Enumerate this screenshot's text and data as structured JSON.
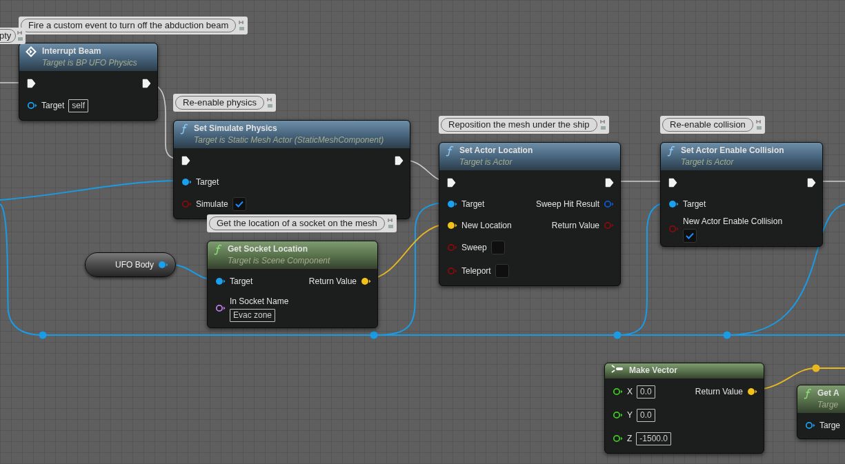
{
  "comments": [
    {
      "text": "pty"
    }
  ],
  "nodes": [
    {
      "kind": "event",
      "comment": "Fire a custom event to turn off the abduction beam",
      "title": "Interrupt Beam",
      "subtitle": "Target is BP UFO Physics",
      "rows": [
        {
          "left": {
            "kind": "exec",
            "connected": true
          },
          "right": {
            "kind": "exec",
            "connected": true
          }
        },
        {
          "left": {
            "kind": "object",
            "label": "Target",
            "connected": false,
            "value": "self"
          }
        }
      ]
    },
    {
      "kind": "function",
      "comment": "Re-enable physics",
      "title": "Set Simulate Physics",
      "subtitle": "Target is Static Mesh Actor (StaticMeshComponent)",
      "rows": [
        {
          "left": {
            "kind": "exec",
            "connected": true
          },
          "right": {
            "kind": "exec",
            "connected": true
          }
        },
        {
          "left": {
            "kind": "object",
            "label": "Target",
            "connected": true
          }
        },
        {
          "left": {
            "kind": "bool",
            "label": "Simulate",
            "connected": false,
            "checked": true
          }
        }
      ]
    },
    {
      "kind": "function",
      "comment": "Reposition the mesh under the ship",
      "title": "Set Actor Location",
      "subtitle": "Target is Actor",
      "rows": [
        {
          "left": {
            "kind": "exec",
            "connected": true
          },
          "right": {
            "kind": "exec",
            "connected": true
          }
        },
        {
          "left": {
            "kind": "object",
            "label": "Target",
            "connected": true
          },
          "right": {
            "kind": "struct",
            "label": "Sweep Hit Result",
            "connected": false
          }
        },
        {
          "left": {
            "kind": "vector",
            "label": "New Location",
            "connected": true
          },
          "right": {
            "kind": "bool",
            "label": "Return Value",
            "connected": false
          }
        },
        {
          "left": {
            "kind": "bool",
            "label": "Sweep",
            "connected": false,
            "checked": false
          }
        },
        {
          "left": {
            "kind": "bool",
            "label": "Teleport",
            "connected": false,
            "checked": false
          }
        }
      ]
    },
    {
      "kind": "function",
      "comment": "Re-enable collision",
      "title": "Set Actor Enable Collision",
      "subtitle": "Target is Actor",
      "rows": [
        {
          "left": {
            "kind": "exec",
            "connected": true
          },
          "right": {
            "kind": "exec",
            "connected": true
          }
        },
        {
          "left": {
            "kind": "object",
            "label": "Target",
            "connected": true
          }
        },
        {
          "left": {
            "kind": "bool",
            "label": "New Actor Enable Collision",
            "connected": false,
            "checked": true
          }
        }
      ]
    },
    {
      "kind": "variable",
      "title": "UFO Body",
      "rows": [
        {
          "right": {
            "kind": "object",
            "connected": true
          }
        }
      ]
    },
    {
      "kind": "pure",
      "comment": "Get the location of a socket on the mesh",
      "title": "Get Socket Location",
      "subtitle": "Target is Scene Component",
      "rows": [
        {
          "left": {
            "kind": "object",
            "label": "Target",
            "connected": true
          },
          "right": {
            "kind": "vector",
            "label": "Return Value",
            "connected": true
          }
        },
        {
          "left": {
            "kind": "name",
            "label": "In Socket Name",
            "connected": false,
            "value": "Evac zone"
          }
        }
      ]
    },
    {
      "kind": "make",
      "title": "Make Vector",
      "rows": [
        {
          "left": {
            "kind": "float",
            "label": "X",
            "connected": false,
            "value": "0.0"
          },
          "right": {
            "kind": "vector",
            "label": "Return Value",
            "connected": true
          }
        },
        {
          "left": {
            "kind": "float",
            "label": "Y",
            "connected": false,
            "value": "0.0"
          }
        },
        {
          "left": {
            "kind": "float",
            "label": "Z",
            "connected": false,
            "value": "-1500.0"
          }
        }
      ]
    },
    {
      "kind": "pure",
      "title": "Get A",
      "subtitle": "Targe",
      "rows": [
        {
          "left": {
            "kind": "object",
            "label": "Targe",
            "connected": false
          }
        }
      ]
    }
  ]
}
